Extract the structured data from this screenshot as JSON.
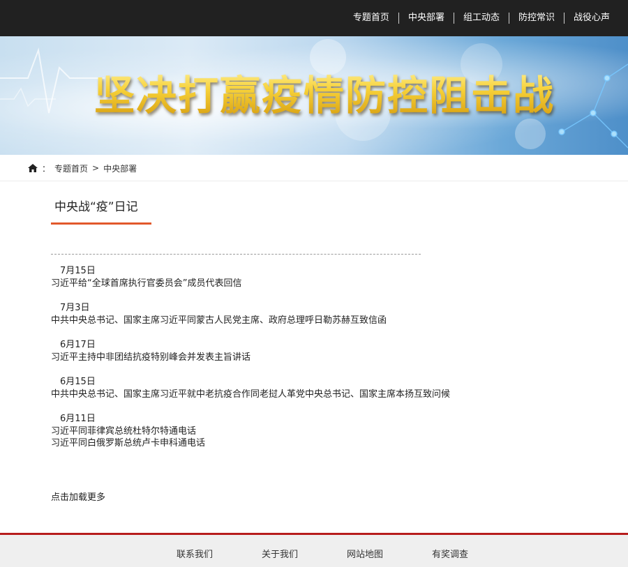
{
  "topnav": {
    "items": [
      "专题首页",
      "中央部署",
      "组工动态",
      "防控常识",
      "战役心声"
    ]
  },
  "banner": {
    "title": "坚决打赢疫情防控阻击战"
  },
  "breadcrumb": {
    "separator": "：",
    "home": "专题首页",
    "arrow": ">",
    "current": "中央部署"
  },
  "section": {
    "title": "中央战“疫”日记"
  },
  "diary": [
    {
      "date": "7月15日",
      "items": [
        "习近平给“全球首席执行官委员会”成员代表回信"
      ]
    },
    {
      "date": "7月3日",
      "items": [
        "中共中央总书记、国家主席习近平同蒙古人民党主席、政府总理呼日勒苏赫互致信函"
      ]
    },
    {
      "date": "6月17日",
      "items": [
        "习近平主持中非团结抗疫特别峰会并发表主旨讲话"
      ]
    },
    {
      "date": "6月15日",
      "items": [
        "中共中央总书记、国家主席习近平就中老抗疫合作同老挝人革党中央总书记、国家主席本扬互致问候"
      ]
    },
    {
      "date": "6月11日",
      "items": [
        "习近平同菲律宾总统杜特尔特通电话",
        "习近平同白俄罗斯总统卢卡申科通电话"
      ]
    }
  ],
  "load_more": "点击加载更多",
  "footer": {
    "links": [
      "联系我们",
      "关于我们",
      "网站地图",
      "有奖调查"
    ]
  },
  "colors": {
    "topbar": "#212121",
    "accent_orange": "#e2592b",
    "footer_red": "#b71c1c",
    "footer_bg": "#efefef"
  }
}
